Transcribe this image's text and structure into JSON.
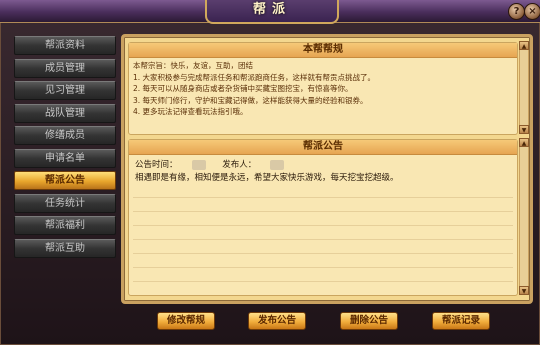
{
  "window": {
    "title": "帮派",
    "help_label": "?",
    "close_label": "×"
  },
  "nav": {
    "items": [
      {
        "label": "帮派资料"
      },
      {
        "label": "成员管理"
      },
      {
        "label": "见习管理"
      },
      {
        "label": "战队管理"
      },
      {
        "label": "修缮成员"
      },
      {
        "label": "申请名单"
      },
      {
        "label": "帮派公告",
        "active": true
      },
      {
        "label": "任务统计"
      },
      {
        "label": "帮派福利"
      },
      {
        "label": "帮派互助"
      }
    ]
  },
  "rules": {
    "title": "本帮帮规",
    "lines": [
      "本帮宗旨：快乐，友谊，互助，团结",
      "1. 大家积极参与完成帮派任务和帮派跑商任务，这样就有帮贡点挑战了。",
      "2. 每天可以从随身商店或者杂货铺中买藏宝图挖宝，有惊喜等你。",
      "3. 每天师门修行，守护和宝藏记得做，这样能获得大量的经验和银券。",
      "4. 更多玩法记得查看玩法指引哦。"
    ]
  },
  "notice": {
    "title": "帮派公告",
    "time_label": "公告时间：",
    "publisher_label": "发布人：",
    "body": "相遇即是有缘，相知便是永远，希望大家快乐游戏，每天挖宝挖超级。"
  },
  "buttons": {
    "edit_rules": "修改帮规",
    "publish_notice": "发布公告",
    "delete_notice": "删除公告",
    "gang_log": "帮派记录"
  }
}
